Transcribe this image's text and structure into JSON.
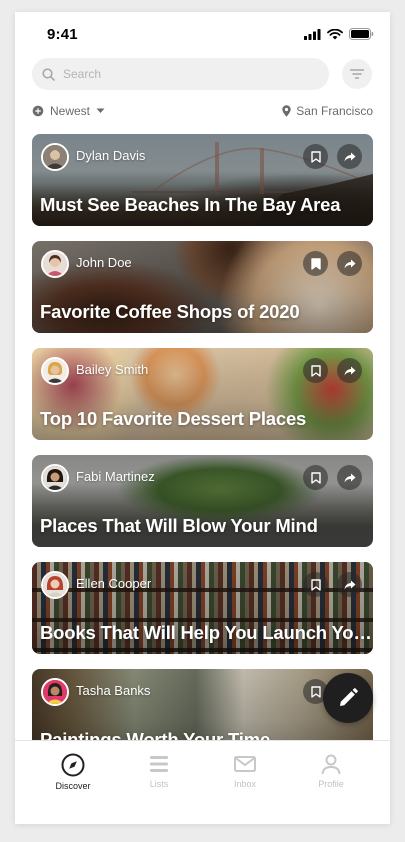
{
  "status_bar": {
    "time": "9:41"
  },
  "search": {
    "placeholder": "Search",
    "value": ""
  },
  "filters": {
    "sort_label": "Newest",
    "location_label": "San Francisco"
  },
  "feed": [
    {
      "author": "Dylan Davis",
      "title": "Must See Beaches In The Bay Area"
    },
    {
      "author": "John Doe",
      "title": "Favorite Coffee Shops of 2020"
    },
    {
      "author": "Bailey Smith",
      "title": "Top 10 Favorite Dessert Places"
    },
    {
      "author": "Fabi Martinez",
      "title": "Places That Will Blow Your Mind"
    },
    {
      "author": "Ellen Cooper",
      "title": "Books That Will Help You Launch Your Business"
    },
    {
      "author": "Tasha Banks",
      "title": "Paintings Worth Your Time"
    }
  ],
  "tabs": [
    {
      "label": "Discover",
      "icon": "compass-icon",
      "active": true
    },
    {
      "label": "Lists",
      "icon": "list-icon",
      "active": false
    },
    {
      "label": "Inbox",
      "icon": "mail-icon",
      "active": false
    },
    {
      "label": "Profile",
      "icon": "profile-icon",
      "active": false
    }
  ],
  "colors": {
    "accent": "#1f1f1f",
    "inactive": "#c2c2c2",
    "surface": "#f0f0f0"
  }
}
